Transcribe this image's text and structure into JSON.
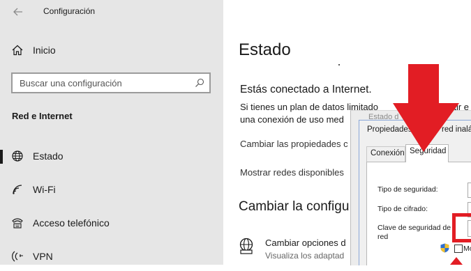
{
  "window": {
    "title": "Configuración"
  },
  "sidebar": {
    "home_label": "Inicio",
    "search_placeholder": "Buscar una configuración",
    "section_heading": "Red e Internet",
    "items": [
      {
        "label": "Estado",
        "icon": "globe-icon",
        "active": true
      },
      {
        "label": "Wi-Fi",
        "icon": "wifi-icon",
        "active": false
      },
      {
        "label": "Acceso telefónico",
        "icon": "dialup-icon",
        "active": false
      },
      {
        "label": "VPN",
        "icon": "vpn-icon",
        "active": false
      }
    ]
  },
  "main": {
    "title": "Estado",
    "connected_heading": "Estás conectado a Internet.",
    "description_line1": "Si tienes un plan de datos limitado",
    "description_line1_tail": "rtir e",
    "description_line2": "una conexión de uso med",
    "link_change_props": "Cambiar las propiedades c",
    "link_show_networks": "Mostrar redes disponibles",
    "section2_heading": "Cambiar la configu",
    "adapter_title": "Cambiar opciones d",
    "adapter_subtitle": "Visualiza los adaptad"
  },
  "dialog": {
    "behind_title": "Estado d",
    "title_part1": "Propiedades",
    "title_part2": "red inalám",
    "tabs": [
      "Conexión",
      "Seguridad"
    ],
    "active_tab": "Seguridad",
    "fields": {
      "security_type_label": "Tipo de seguridad:",
      "encryption_type_label": "Tipo de cifrado:",
      "security_key_label_line1": "Clave de seguridad de",
      "security_key_label_line2": "red"
    },
    "show_chars_label": "Mo"
  },
  "colors": {
    "sidebar_bg": "#e6e6e6",
    "annotation_red": "#e21d24",
    "dialog_bg": "#f0f0f0"
  }
}
